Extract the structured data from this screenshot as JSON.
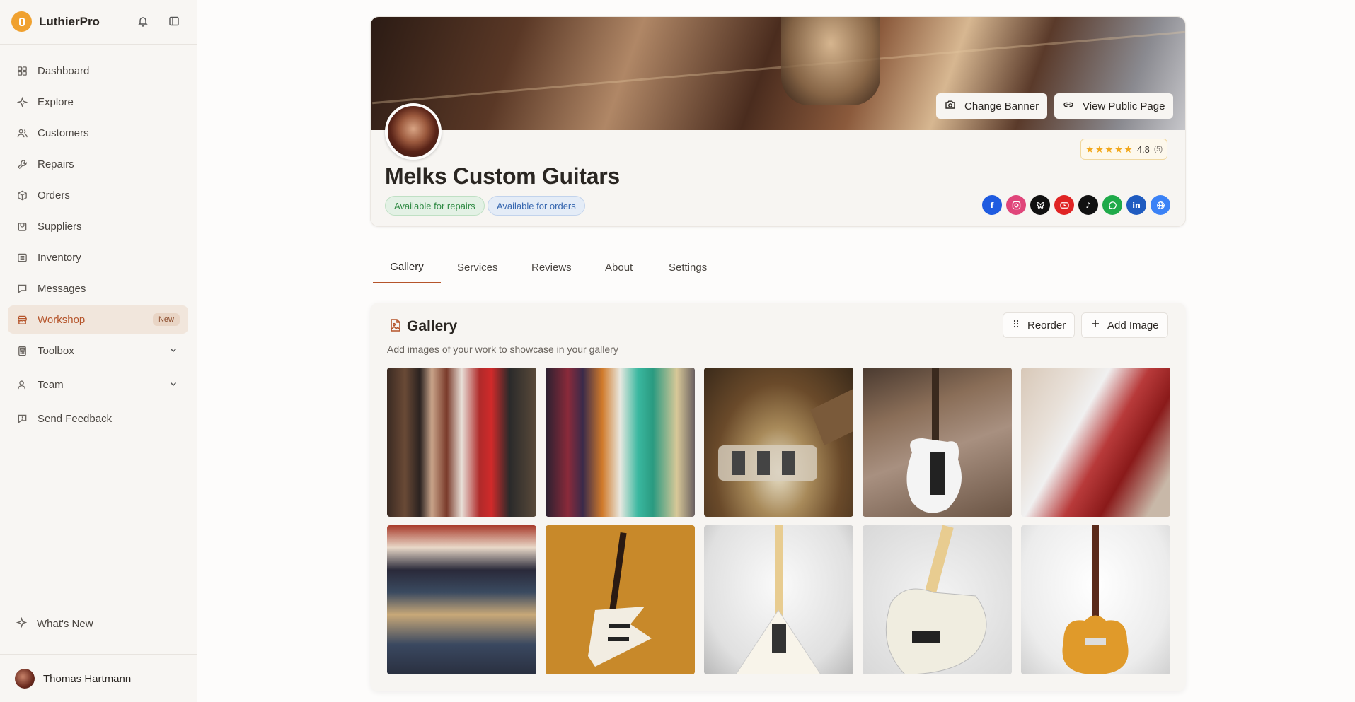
{
  "app": {
    "name": "LuthierPro",
    "colors": {
      "accent": "#b5542a",
      "brand": "#f0a12f",
      "star": "#f2a81c"
    }
  },
  "sidebar": {
    "items": [
      {
        "label": "Dashboard",
        "icon": "dashboard-icon"
      },
      {
        "label": "Explore",
        "icon": "sparkle-icon"
      },
      {
        "label": "Customers",
        "icon": "users-icon"
      },
      {
        "label": "Repairs",
        "icon": "wrench-icon"
      },
      {
        "label": "Orders",
        "icon": "box-icon"
      },
      {
        "label": "Suppliers",
        "icon": "package-icon"
      },
      {
        "label": "Inventory",
        "icon": "inventory-icon"
      },
      {
        "label": "Messages",
        "icon": "message-icon"
      },
      {
        "label": "Workshop",
        "icon": "store-icon",
        "active": true,
        "badge": "New"
      },
      {
        "label": "Toolbox",
        "icon": "calculator-icon"
      },
      {
        "label": "Team",
        "icon": "team-icon"
      },
      {
        "label": "Send Feedback",
        "icon": "feedback-icon"
      }
    ],
    "whats_new": "What's New",
    "user": {
      "name": "Thomas Hartmann"
    }
  },
  "profile": {
    "change_banner": "Change Banner",
    "view_public_page": "View Public Page",
    "rating": {
      "value": "4.8",
      "count": "(5)",
      "stars": 5
    },
    "name": "Melks Custom Guitars",
    "pills": {
      "repairs": "Available for repairs",
      "orders": "Available for orders"
    },
    "socials": [
      {
        "name": "facebook-icon",
        "color": "#1f5be0"
      },
      {
        "name": "instagram-icon",
        "color": "#e0457a"
      },
      {
        "name": "bluesky-icon",
        "color": "#111111"
      },
      {
        "name": "youtube-icon",
        "color": "#e02424"
      },
      {
        "name": "tiktok-icon",
        "color": "#111111"
      },
      {
        "name": "whatsapp-icon",
        "color": "#1faa4a"
      },
      {
        "name": "linkedin-icon",
        "color": "#1f5bc0"
      },
      {
        "name": "website-icon",
        "color": "#3b82f6"
      }
    ]
  },
  "tabs": [
    {
      "label": "Gallery",
      "active": true
    },
    {
      "label": "Services"
    },
    {
      "label": "Reviews"
    },
    {
      "label": "About"
    },
    {
      "label": "Settings"
    }
  ],
  "gallery": {
    "title": "Gallery",
    "subtitle": "Add images of your work to showcase in your gallery",
    "reorder": "Reorder",
    "add_image": "Add Image",
    "image_count": 10
  }
}
